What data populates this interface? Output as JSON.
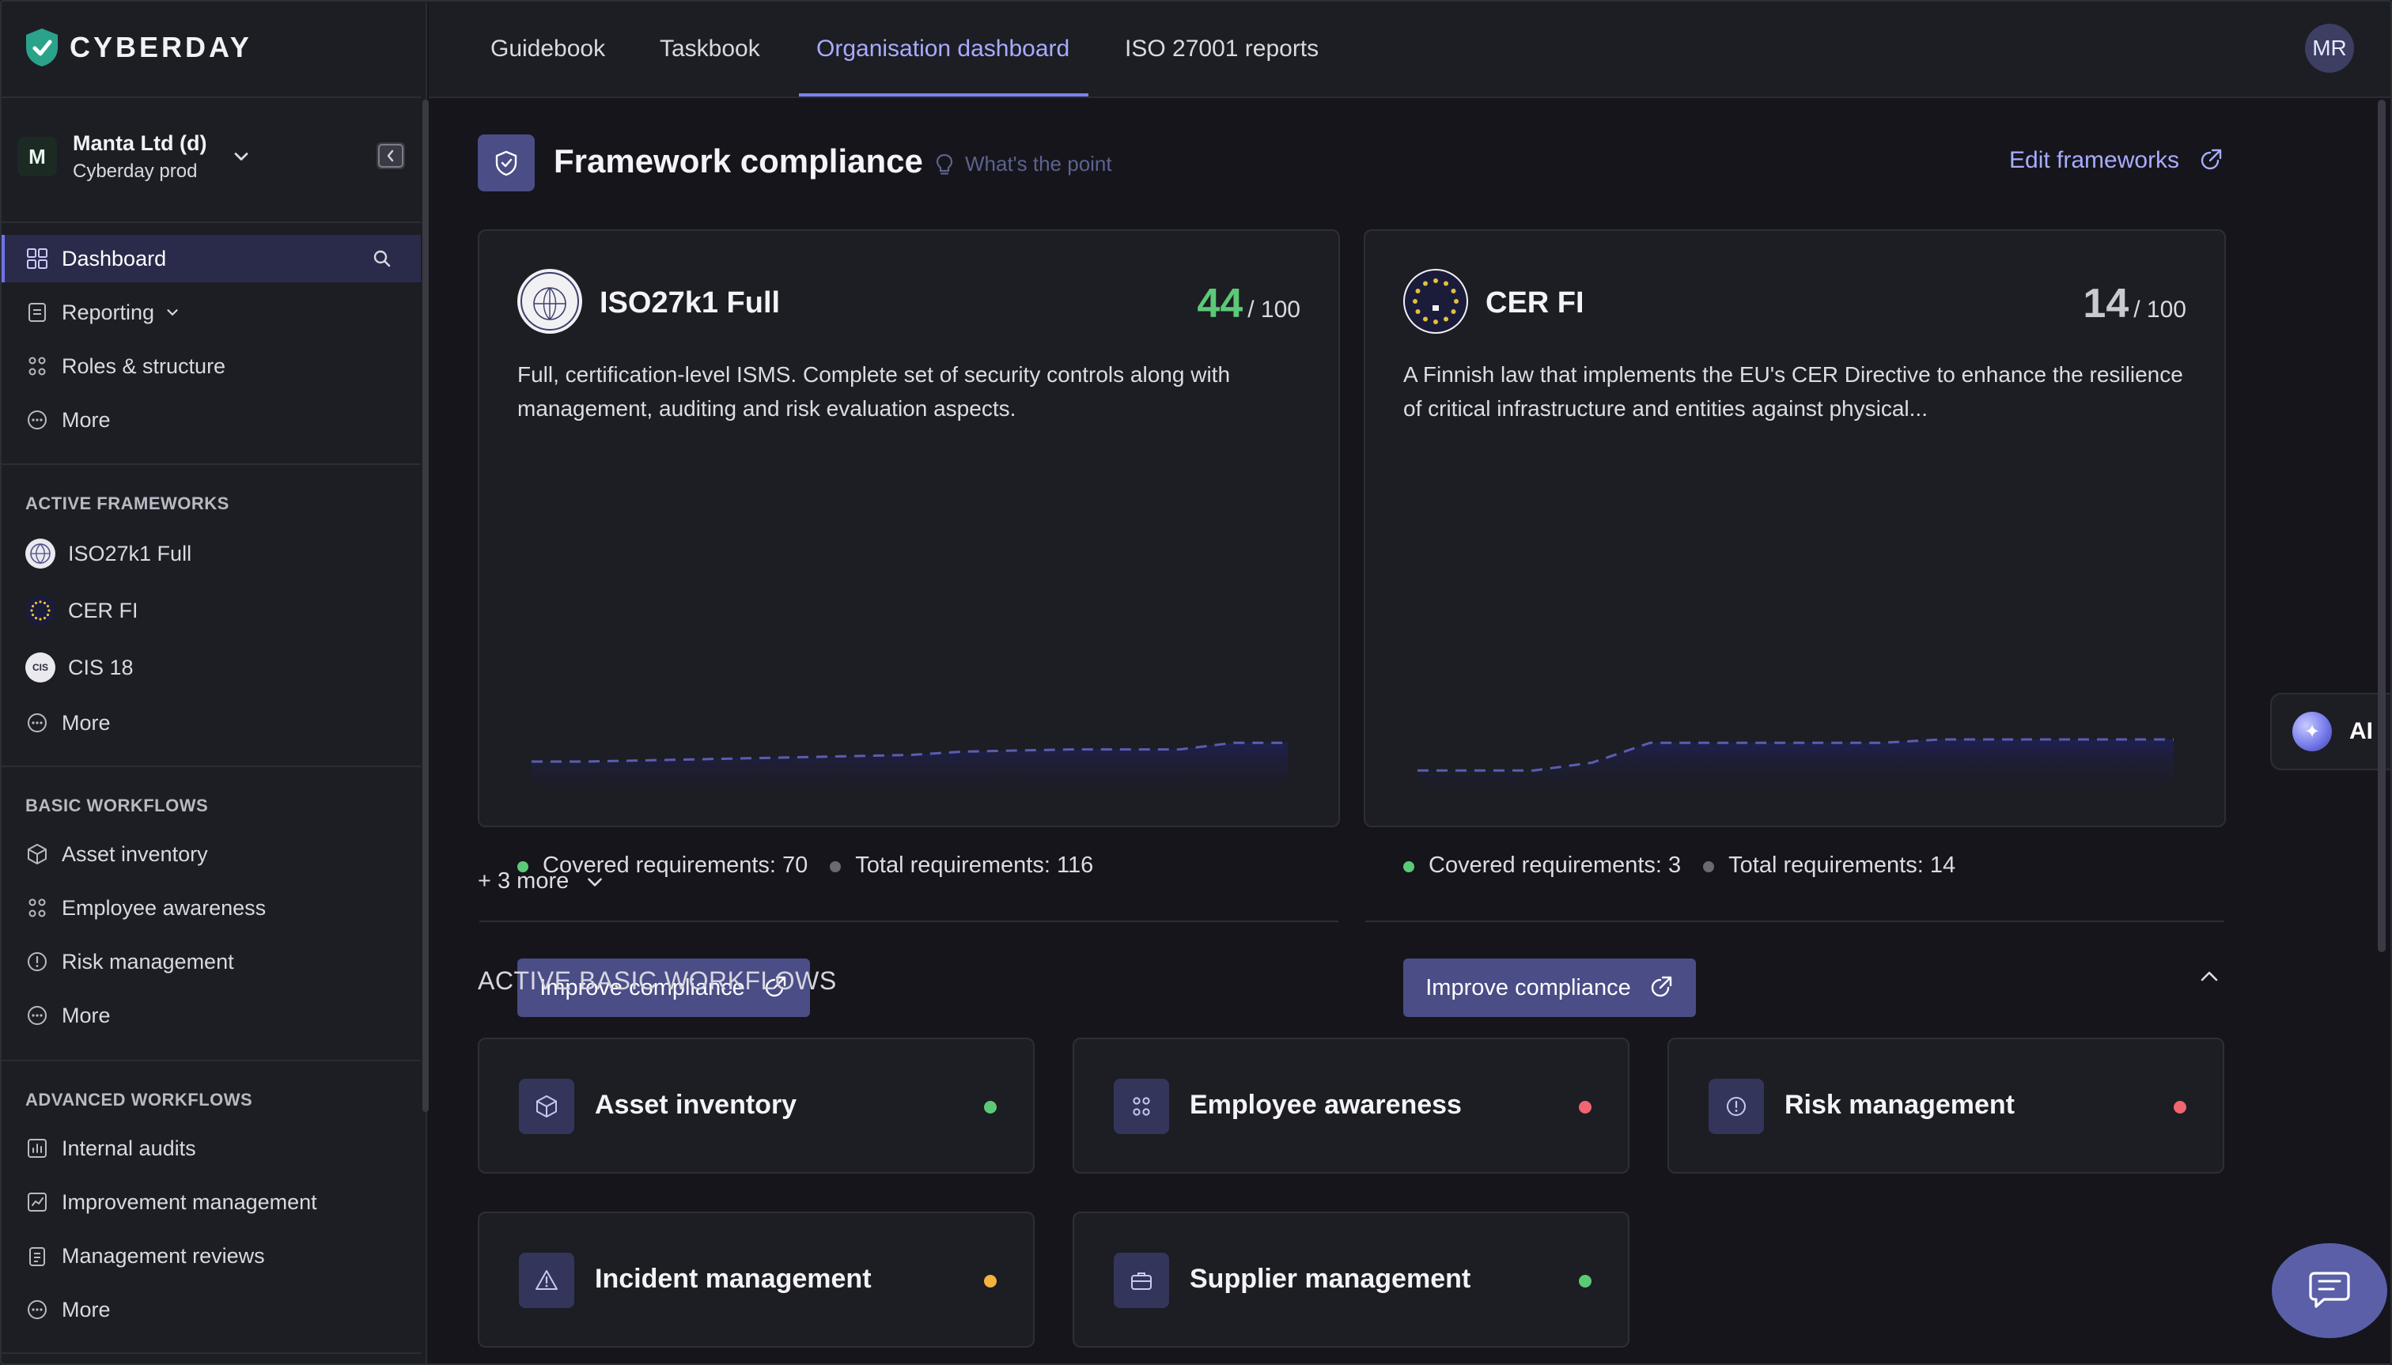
{
  "app": {
    "brand": "CYBERDAY",
    "user_initials": "MR"
  },
  "org": {
    "avatar_letter": "M",
    "name": "Manta Ltd (d)",
    "environment": "Cyberday prod"
  },
  "sidebar": {
    "nav": [
      {
        "label": "Dashboard",
        "icon": "grid-icon",
        "active": true
      },
      {
        "label": "Reporting",
        "icon": "report-icon"
      },
      {
        "label": "Roles & structure",
        "icon": "people-icon"
      },
      {
        "label": "More",
        "icon": "more-icon"
      }
    ],
    "active_frameworks_title": "ACTIVE FRAMEWORKS",
    "frameworks": [
      {
        "label": "ISO27k1 Full"
      },
      {
        "label": "CER FI"
      },
      {
        "label": "CIS 18",
        "badge": "CIS"
      },
      {
        "label": "More"
      }
    ],
    "basic_workflows_title": "BASIC WORKFLOWS",
    "basic_workflows": [
      {
        "label": "Asset inventory"
      },
      {
        "label": "Employee awareness"
      },
      {
        "label": "Risk management"
      },
      {
        "label": "More"
      }
    ],
    "advanced_workflows_title": "ADVANCED WORKFLOWS",
    "advanced_workflows": [
      {
        "label": "Internal audits"
      },
      {
        "label": "Improvement management"
      },
      {
        "label": "Management reviews"
      },
      {
        "label": "More"
      }
    ]
  },
  "tabs": [
    {
      "label": "Guidebook"
    },
    {
      "label": "Taskbook"
    },
    {
      "label": "Organisation dashboard",
      "active": true
    },
    {
      "label": "ISO 27001 reports"
    }
  ],
  "framework_compliance": {
    "title": "Framework compliance",
    "hint": "What's the point",
    "edit_label": "Edit frameworks",
    "cards": [
      {
        "name": "ISO27k1 Full",
        "score": "44",
        "score_max": "/ 100",
        "score_color": "#5cc977",
        "description": "Full, certification-level ISMS. Complete set of security controls along with management, auditing and risk evaluation aspects.",
        "covered": "Covered requirements: 70",
        "total": "Total requirements: 116",
        "trend": [
          0.35,
          0.35,
          0.36,
          0.37,
          0.38,
          0.39,
          0.4,
          0.41,
          0.44,
          0.45,
          0.46,
          0.46,
          0.46,
          0.52,
          0.52
        ],
        "button": "Improve compliance"
      },
      {
        "name": "CER FI",
        "score": "14",
        "score_max": "/ 100",
        "score_color": "#c9c9d2",
        "description": "A Finnish law that implements the EU's CER Directive to enhance the resilience of critical infrastructure and entities against physical...",
        "covered": "Covered requirements: 3",
        "total": "Total requirements: 14",
        "trend": [
          0.27,
          0.27,
          0.27,
          0.34,
          0.52,
          0.52,
          0.52,
          0.52,
          0.52,
          0.55,
          0.55,
          0.55,
          0.55,
          0.55
        ],
        "button": "Improve compliance"
      }
    ],
    "more_label": "+ 3 more"
  },
  "basic_workflows": {
    "title": "ACTIVE BASIC WORKFLOWS",
    "cards": [
      {
        "label": "Asset inventory",
        "status": "#5cc977"
      },
      {
        "label": "Employee awareness",
        "status": "#f0656f"
      },
      {
        "label": "Risk management",
        "status": "#f0656f"
      },
      {
        "label": "Incident management",
        "status": "#f4b33d"
      },
      {
        "label": "Supplier management",
        "status": "#5cc977"
      }
    ]
  },
  "assistant": {
    "label": "AI"
  },
  "colors": {
    "accent": "#6f74e8",
    "background": "#15151b",
    "panel": "#1d1d24",
    "ok": "#5cc977",
    "warning": "#f4b33d",
    "bad": "#f0656f"
  }
}
